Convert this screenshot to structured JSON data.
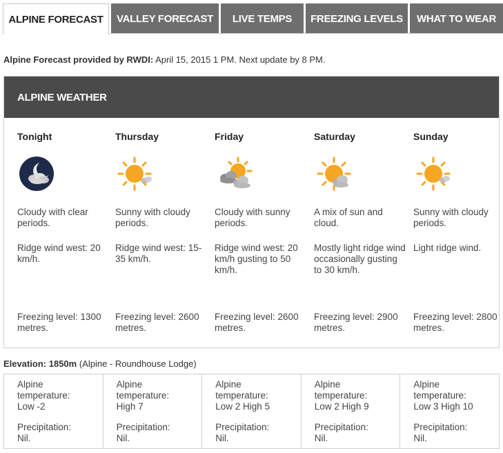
{
  "tabs": [
    {
      "label": "Alpine Forecast",
      "active": true
    },
    {
      "label": "Valley Forecast",
      "active": false
    },
    {
      "label": "Live Temps",
      "active": false
    },
    {
      "label": "Freezing Levels",
      "active": false
    },
    {
      "label": "What to Wear",
      "active": false
    }
  ],
  "provided": {
    "label": "Alpine Forecast provided by RWDI:",
    "text": " April 15, 2015 1 PM. Next update by 8 PM."
  },
  "panel": {
    "title": "Alpine Weather",
    "days": [
      {
        "name": "Tonight",
        "icon": "moon-cloudy-icon",
        "condition": "Cloudy with clear periods.",
        "wind": "Ridge wind west: 20 km/h.",
        "freezing": "Freezing level: 1300 metres."
      },
      {
        "name": "Thursday",
        "icon": "sun-small-cloud-icon",
        "condition": "Sunny with cloudy periods.",
        "wind": "Ridge wind west: 15-35 km/h.",
        "freezing": "Freezing level: 2600 metres."
      },
      {
        "name": "Friday",
        "icon": "cloudy-sun-icon",
        "condition": "Cloudy with sunny periods.",
        "wind": "Ridge wind west: 20 km/h gusting to 50 km/h.",
        "freezing": "Freezing level: 2600 metres."
      },
      {
        "name": "Saturday",
        "icon": "sun-cloud-mix-icon",
        "condition": "A mix of sun and cloud.",
        "wind": "Mostly light ridge wind occasionally gusting to 30 km/h.",
        "freezing": "Freezing level: 2900 metres."
      },
      {
        "name": "Sunday",
        "icon": "sun-small-cloud-icon",
        "condition": "Sunny with cloudy periods.",
        "wind": "Light ridge wind.",
        "freezing": "Freezing level: 2800 metres."
      }
    ]
  },
  "elevation": {
    "label": "Elevation: 1850m",
    "text": " (Alpine - Roundhouse Lodge)"
  },
  "temps": [
    {
      "label": "Alpine temperature:",
      "value": "Low -2",
      "precip_label": "Precipitation:",
      "precip": "Nil."
    },
    {
      "label": "Alpine temperature:",
      "value": "High 7",
      "precip_label": "Precipitation:",
      "precip": "Nil."
    },
    {
      "label": "Alpine temperature:",
      "value": "Low 2 High 5",
      "precip_label": "Precipitation:",
      "precip": "Nil."
    },
    {
      "label": "Alpine temperature:",
      "value": "Low 2 High 9",
      "precip_label": "Precipitation:",
      "precip": "Nil."
    },
    {
      "label": "Alpine temperature:",
      "value": "Low 3 High 10",
      "precip_label": "Precipitation:",
      "precip": "Nil."
    }
  ],
  "colors": {
    "tab_inactive": "#6e6e6e",
    "header": "#4a4a4a",
    "sun": "#f5a623",
    "cloud": "#b5b5b5",
    "moon_bg": "#1e2a4a"
  }
}
